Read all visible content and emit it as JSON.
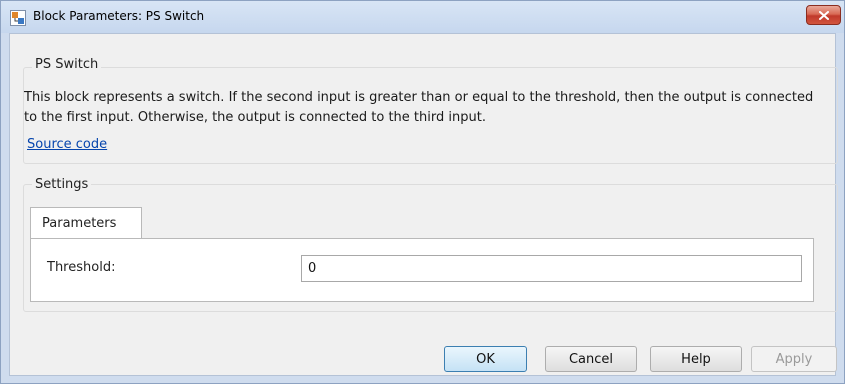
{
  "window": {
    "title": "Block Parameters: PS Switch"
  },
  "description_group": {
    "title": "PS Switch",
    "text": "This block represents a switch. If the second input is greater than or equal to the threshold, then the output is connected to the first input. Otherwise, the output is connected to the third input.",
    "link": "Source code"
  },
  "settings_group": {
    "title": "Settings",
    "tabs": [
      {
        "label": "Parameters",
        "selected": true
      }
    ],
    "fields": [
      {
        "label": "Threshold:",
        "value": "0"
      }
    ]
  },
  "buttons": {
    "ok": "OK",
    "cancel": "Cancel",
    "help": "Help",
    "apply": "Apply"
  },
  "icons": {
    "app": "simulink-block-icon",
    "close": "close-icon"
  },
  "colors": {
    "link": "#0645ad",
    "close_button": "#c0392b",
    "disabled_text": "#9a9a9a"
  }
}
